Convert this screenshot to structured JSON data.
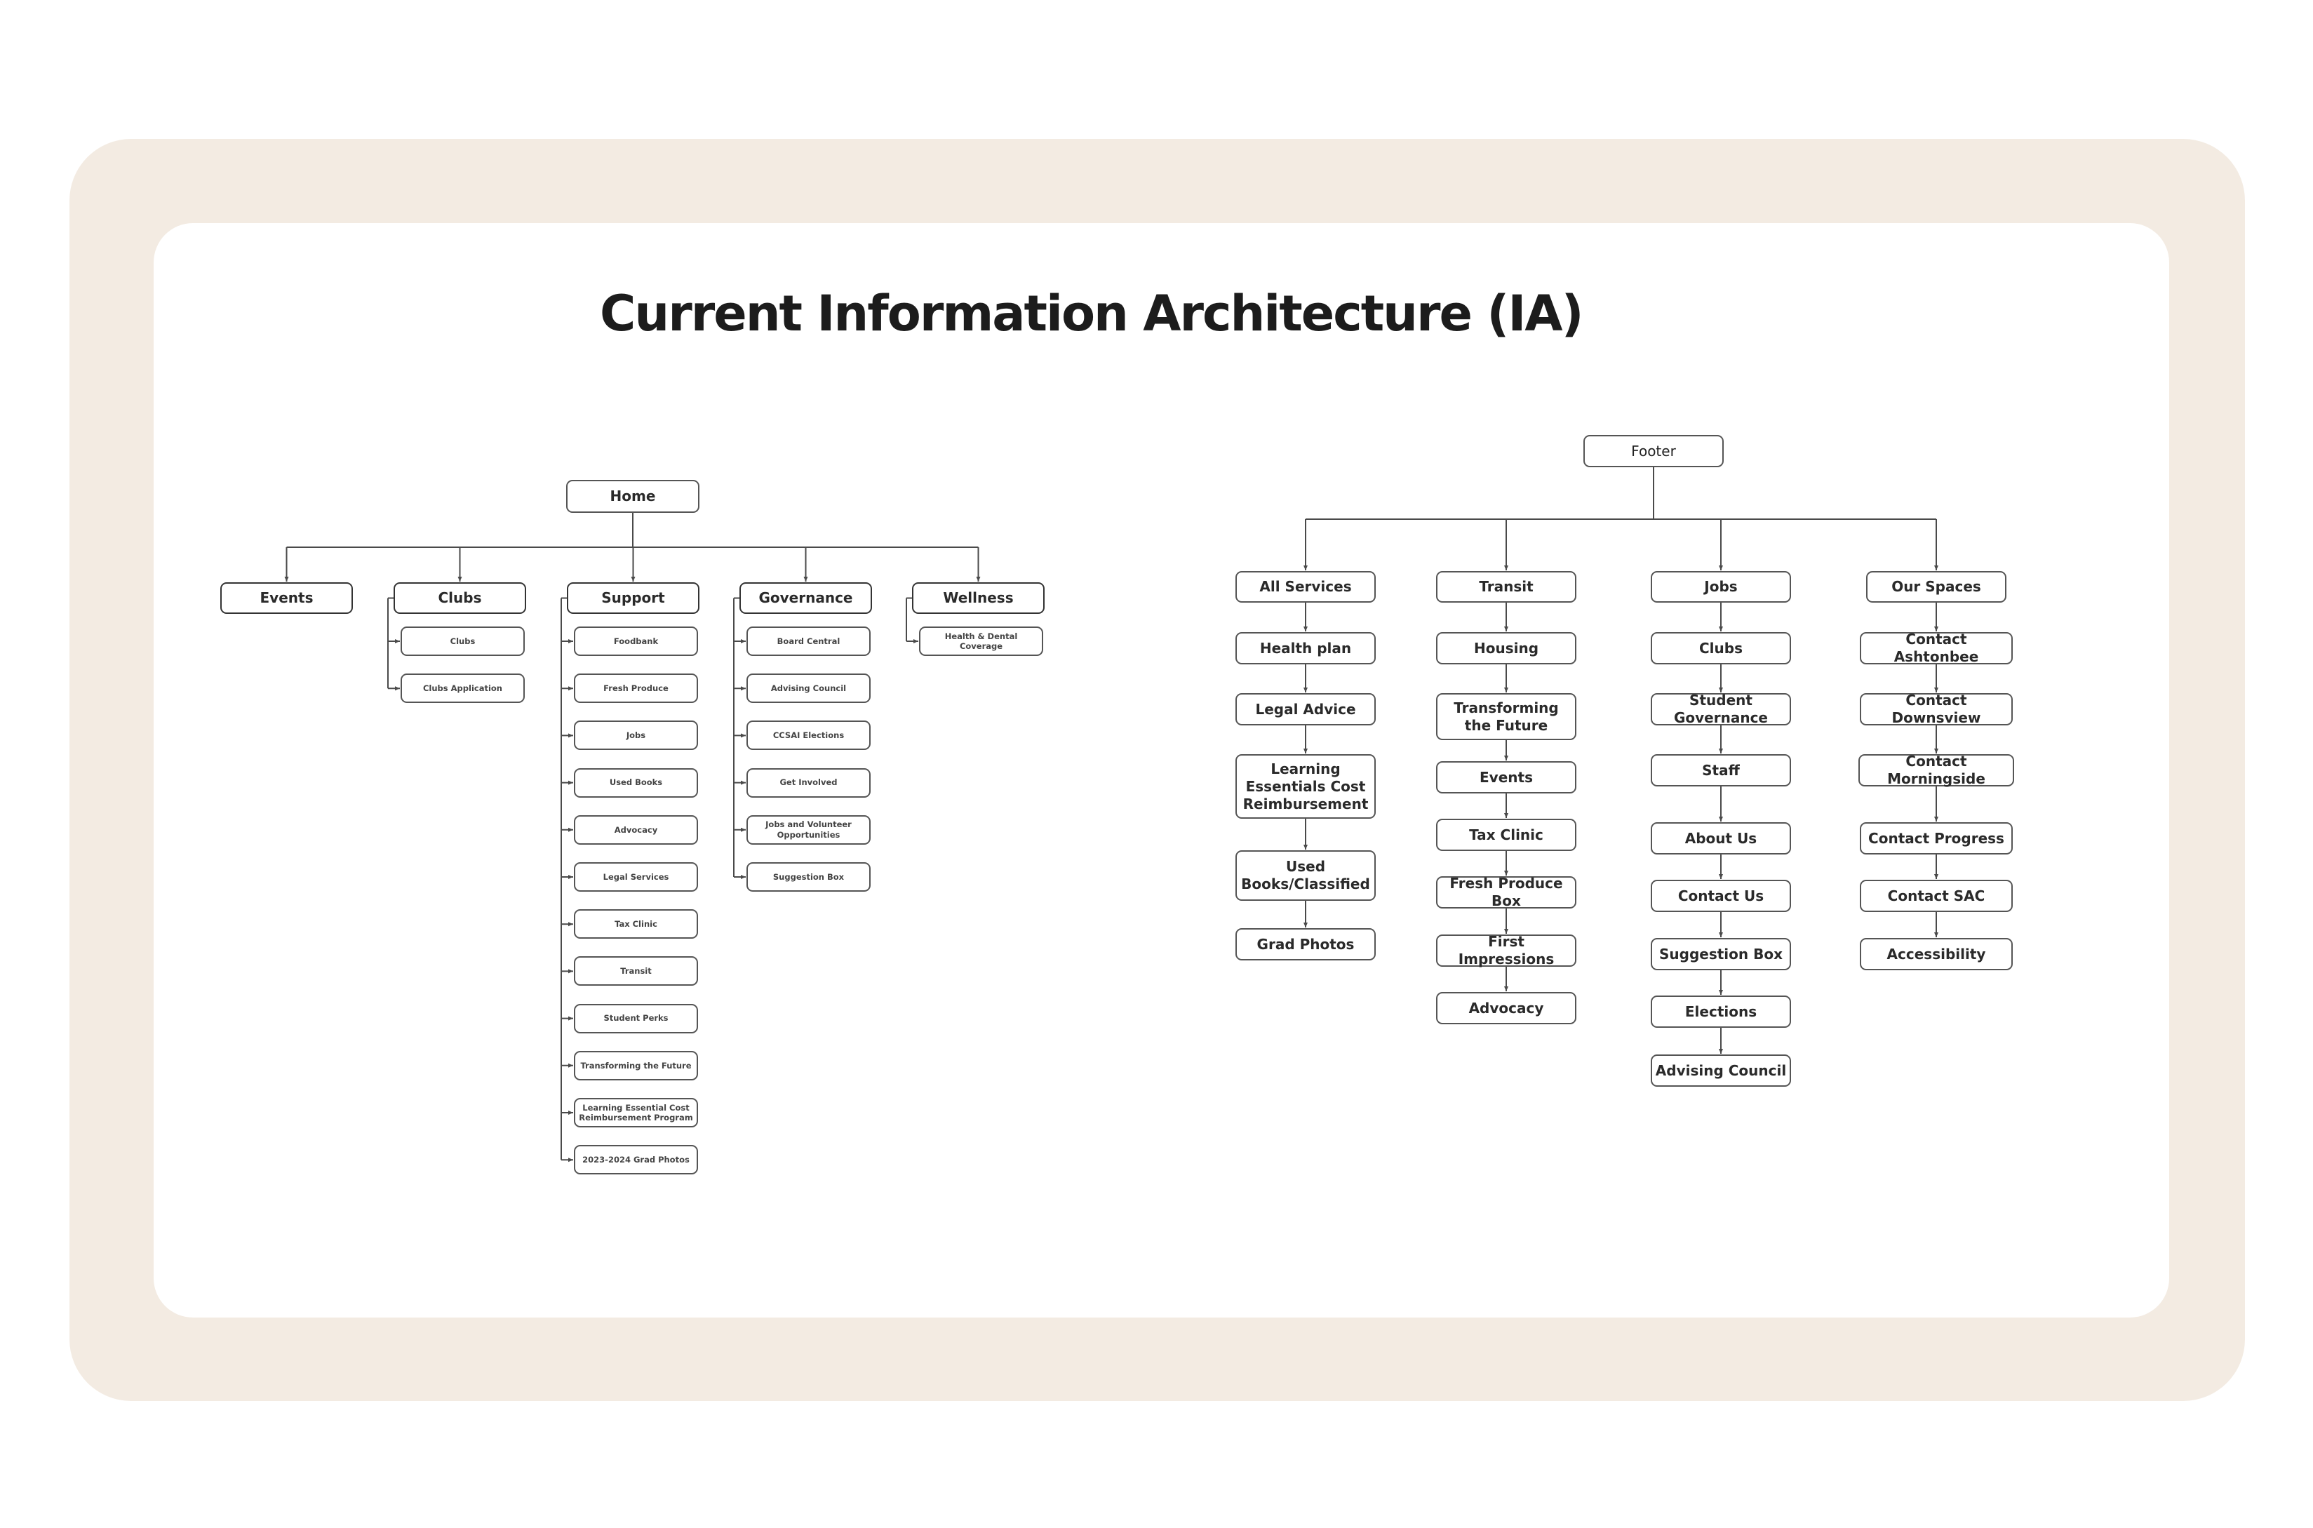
{
  "title": "Current Information Architecture (IA)",
  "colors": {
    "frame": "#f3ebe2",
    "canvas": "#ffffff",
    "line": "#4a4a4a",
    "text": "#1c1c1c"
  },
  "home_tree": {
    "root": "Home",
    "sections": [
      {
        "label": "Events",
        "children": []
      },
      {
        "label": "Clubs",
        "children": [
          "Clubs",
          "Clubs Application"
        ]
      },
      {
        "label": "Support",
        "children": [
          "Foodbank",
          "Fresh Produce",
          "Jobs",
          "Used Books",
          "Advocacy",
          "Legal Services",
          "Tax Clinic",
          "Transit",
          "Student Perks",
          "Transforming the Future",
          "Learning Essential Cost Reimbursement Program",
          "2023-2024 Grad Photos"
        ]
      },
      {
        "label": "Governance",
        "children": [
          "Board Central",
          "Advising Council",
          "CCSAI Elections",
          "Get Involved",
          "Jobs and Volunteer Opportunities",
          "Suggestion Box"
        ]
      },
      {
        "label": "Wellness",
        "children": [
          "Health & Dental Coverage"
        ]
      }
    ]
  },
  "footer_tree": {
    "root": "Footer",
    "columns": [
      {
        "label": "All Services",
        "children": [
          "Health plan",
          "Legal Advice",
          "Learning Essentials Cost Reimbursement",
          "Used Books/Classified",
          "Grad Photos"
        ]
      },
      {
        "label": "Transit",
        "children": [
          "Housing",
          "Transforming the Future",
          "Events",
          "Tax Clinic",
          "Fresh Produce Box",
          "First Impressions",
          "Advocacy"
        ]
      },
      {
        "label": "Jobs",
        "children": [
          "Clubs",
          "Student Governance",
          "Staff",
          "About Us",
          "Contact Us",
          "Suggestion Box",
          "Elections",
          "Advising Council"
        ]
      },
      {
        "label": "Our Spaces",
        "children": [
          "Contact Ashtonbee",
          "Contact Downsview",
          "Contact Morningside",
          "Contact Progress",
          "Contact SAC",
          "Accessibility"
        ]
      }
    ]
  }
}
